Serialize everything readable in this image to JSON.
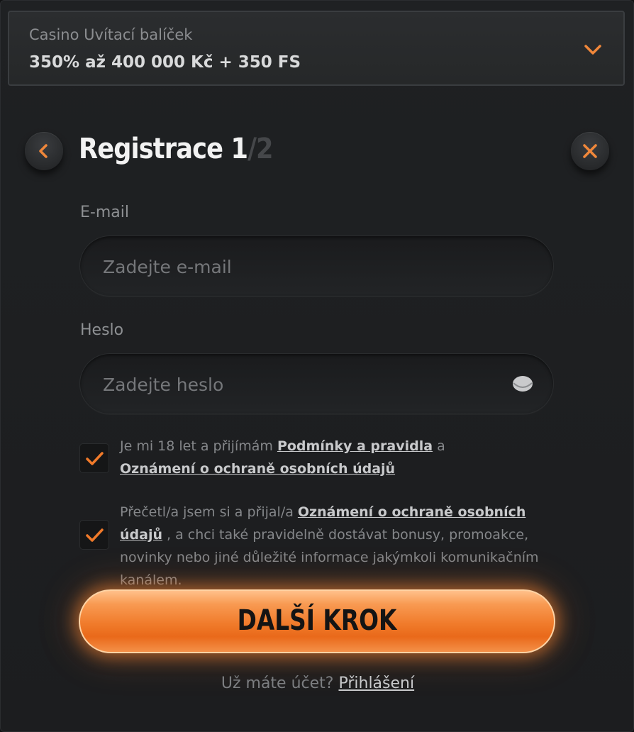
{
  "bonus": {
    "title": "Casino Uvítací balíček",
    "value": "350% až 400 000 Kč + 350 FS"
  },
  "header": {
    "title": "Registrace 1",
    "step_separator_total": "/2"
  },
  "form": {
    "email": {
      "label": "E-mail",
      "placeholder": "Zadejte e-mail",
      "value": ""
    },
    "password": {
      "label": "Heslo",
      "placeholder": "Zadejte heslo",
      "value": ""
    }
  },
  "consents": [
    {
      "checked": true,
      "text_before": "Je mi 18 let a přijímám ",
      "link1": "Podmínky a pravidla",
      "text_middle": " a ",
      "link2": "Oznámení o ochraně osobních údajů"
    },
    {
      "checked": true,
      "text_before": "Přečetl/a jsem si a přijal/a ",
      "link1": "Oznámení o ochraně osobních údajů",
      "text_after": " , a chci také pravidelně dostávat bonusy, promoakce, novinky nebo jiné důležité informace jakýmkoli komunikačním kanálem."
    }
  ],
  "cta": {
    "label": "DALŠÍ KROK"
  },
  "login": {
    "prompt": "Už máte účet? ",
    "link": "Přihlášení"
  },
  "colors": {
    "accent": "#f07a2a",
    "background": "#1f2123"
  }
}
